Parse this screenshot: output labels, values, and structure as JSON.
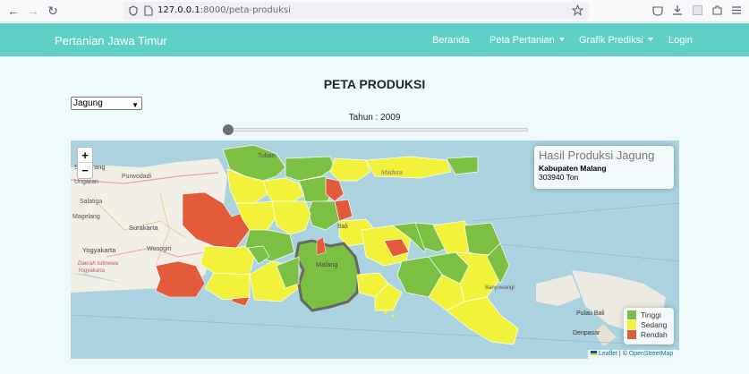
{
  "browser": {
    "url_host": "127.0.0.1",
    "url_rest": ":8000/peta-produksi"
  },
  "navbar": {
    "brand": "Pertanian Jawa Timur",
    "links": [
      {
        "label": "Beranda",
        "dropdown": false
      },
      {
        "label": "Peta Pertanian",
        "dropdown": true
      },
      {
        "label": "Grafik Prediksi",
        "dropdown": true
      },
      {
        "label": "Login",
        "dropdown": false
      }
    ]
  },
  "page": {
    "title": "PETA PRODUKSI",
    "crop_select": {
      "value": "Jagung"
    },
    "year_label": "Tahun : 2009",
    "year_slider": {
      "value_fraction": 0.0
    }
  },
  "map": {
    "zoom_in": "+",
    "zoom_out": "−",
    "info": {
      "title": "Hasil Produksi Jagung",
      "region": "Kabupaten Malang",
      "value": "303940 Ton"
    },
    "legend": [
      {
        "label": "Tinggi",
        "color": "#7bc043"
      },
      {
        "label": "Sedang",
        "color": "#f2f23a"
      },
      {
        "label": "Rendah",
        "color": "#e35b3a"
      }
    ],
    "attribution": {
      "leaflet": "Leaflet",
      "sep": " | © ",
      "osm": "OpenStreetMap"
    },
    "labels": {
      "semarang": "Semarang",
      "ungaran": "Ungaran",
      "purwodadi": "Purwodadi",
      "salatiga": "Salatiga",
      "magelang": "Magelang",
      "surakarta": "Surakarta",
      "yogyakarta": "Yogyakarta",
      "wonogiri": "Wonogiri",
      "diy": "Daerah Istimewa Yogyakarta",
      "tuban": "Tuban",
      "madura": "Madura",
      "bali_label": "Bali",
      "malang": "Malang",
      "pulau_bali": "Pulau Bali",
      "denpasar": "Denpasar",
      "banyuwangi": "Banyuwangi"
    }
  }
}
